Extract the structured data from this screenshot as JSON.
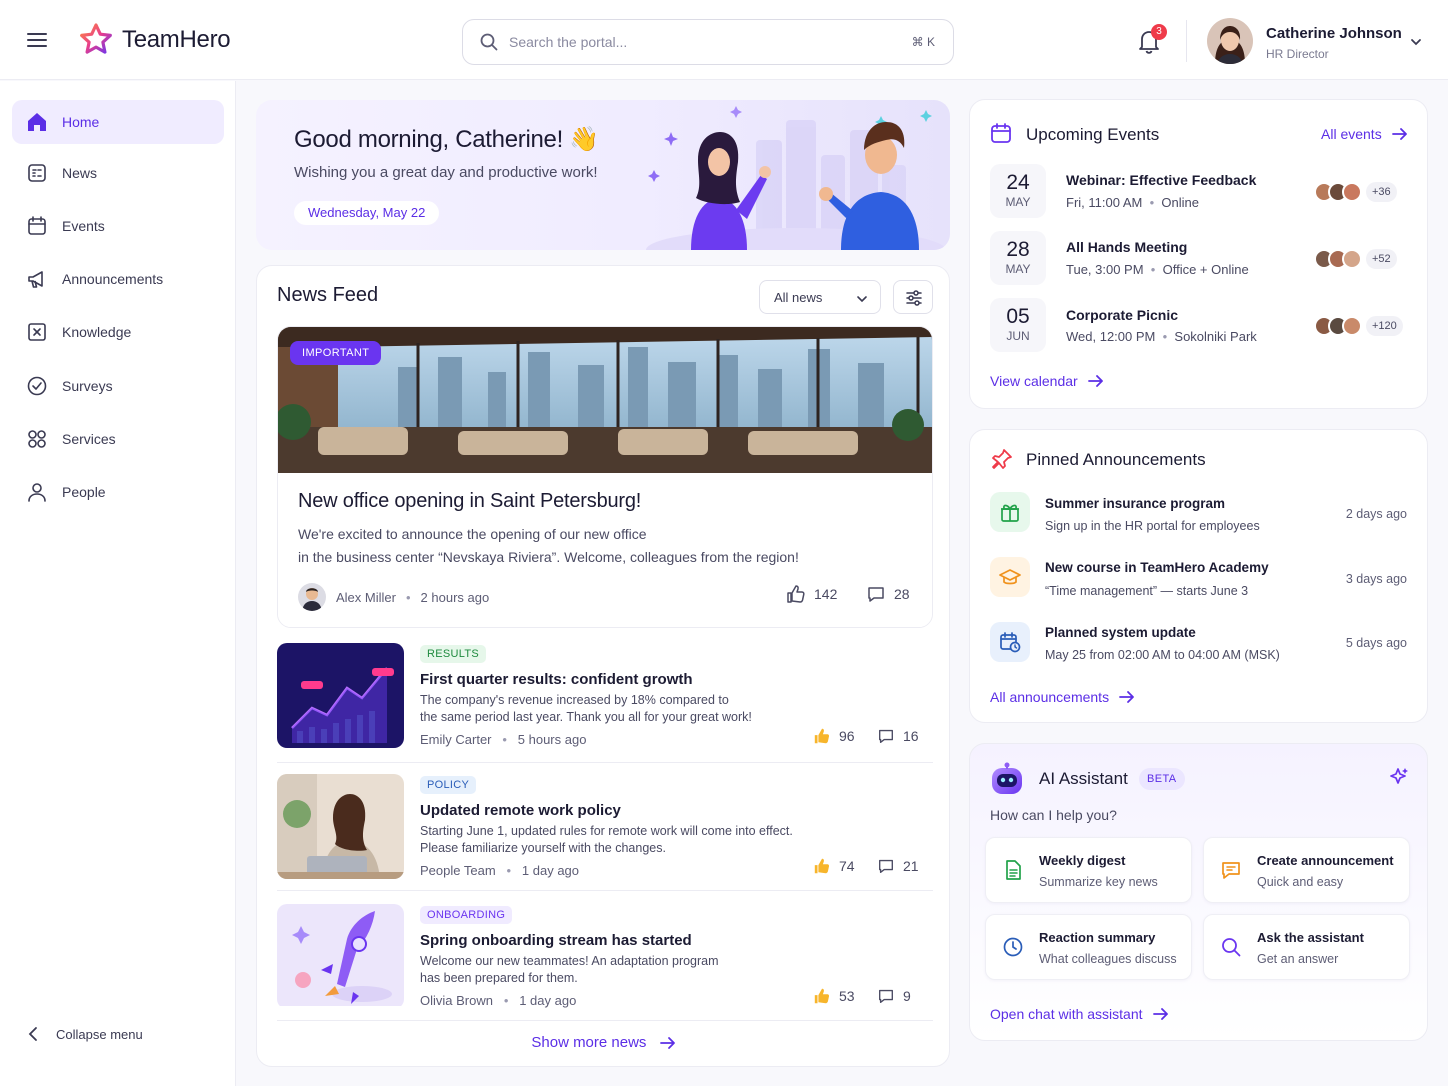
{
  "app": {
    "name": "TeamHero"
  },
  "search": {
    "placeholder": "Search the portal...",
    "shortcut": "⌘ K"
  },
  "notifications": {
    "count": "3"
  },
  "user": {
    "name": "Catherine Johnson",
    "role": "HR Director"
  },
  "sidebar": {
    "items": [
      {
        "label": "Home",
        "icon": "home-icon",
        "active": true
      },
      {
        "label": "News",
        "icon": "news-icon"
      },
      {
        "label": "Events",
        "icon": "calendar-icon"
      },
      {
        "label": "Announcements",
        "icon": "megaphone-icon"
      },
      {
        "label": "Knowledge",
        "icon": "book-icon"
      },
      {
        "label": "Surveys",
        "icon": "check-circle-icon"
      },
      {
        "label": "Services",
        "icon": "grid-icon"
      },
      {
        "label": "People",
        "icon": "person-icon"
      }
    ],
    "collapse_label": "Collapse menu"
  },
  "hero": {
    "greeting": "Good morning, Catherine! 👋",
    "subtitle": "Wishing you a great day and productive work!",
    "date": "Wednesday, May 22"
  },
  "feed": {
    "title": "News Feed",
    "filter": "All news",
    "featured": {
      "badge": "IMPORTANT",
      "title": "New office opening in Saint Petersburg!",
      "text_line1": "We're excited to announce the opening of our new office",
      "text_line2": "in the business center “Nevskaya Riviera”. Welcome, colleagues from the region!",
      "author": "Alex Miller",
      "time": "2 hours ago",
      "likes": "142",
      "comments": "28"
    },
    "items": [
      {
        "tag": "RESULTS",
        "title": "First quarter results: confident growth",
        "text_line1": "The company's revenue increased by 18% compared to",
        "text_line2": "the same period last year. Thank you all for your great work!",
        "author": "Emily Carter",
        "time": "5 hours ago",
        "likes": "96",
        "comments": "16"
      },
      {
        "tag": "POLICY",
        "title": "Updated remote work policy",
        "text_line1": "Starting June 1, updated rules for remote work will come into effect.",
        "text_line2": "Please familiarize yourself with the changes.",
        "author": "People Team",
        "time": "1 day ago",
        "likes": "74",
        "comments": "21"
      },
      {
        "tag": "ONBOARDING",
        "title": "Spring onboarding stream has started",
        "text_line1": "Welcome our new teammates! An adaptation program",
        "text_line2": "has been prepared for them.",
        "author": "Olivia Brown",
        "time": "1 day ago",
        "likes": "53",
        "comments": "9"
      }
    ],
    "show_more": "Show more news"
  },
  "events": {
    "title": "Upcoming Events",
    "all_link": "All events",
    "items": [
      {
        "day": "24",
        "month": "MAY",
        "title": "Webinar: Effective Feedback",
        "when": "Fri, 11:00 AM",
        "where": "Online",
        "more": "+36"
      },
      {
        "day": "28",
        "month": "MAY",
        "title": "All Hands Meeting",
        "when": "Tue, 3:00 PM",
        "where": "Office + Online",
        "more": "+52"
      },
      {
        "day": "05",
        "month": "JUN",
        "title": "Corporate Picnic",
        "when": "Wed, 12:00 PM",
        "where": "Sokolniki Park",
        "more": "+120"
      }
    ],
    "view_calendar": "View calendar"
  },
  "pinned": {
    "title": "Pinned Announcements",
    "items": [
      {
        "title": "Summer insurance program",
        "sub": "Sign up in the HR portal for employees",
        "time": "2 days ago"
      },
      {
        "title": "New course in TeamHero Academy",
        "sub": "“Time management” — starts June 3",
        "time": "3 days ago"
      },
      {
        "title": "Planned system update",
        "sub": "May 25 from 02:00 AM to 04:00 AM (MSK)",
        "time": "5 days ago"
      }
    ],
    "all_link": "All announcements"
  },
  "ai": {
    "title": "AI Assistant",
    "beta": "BETA",
    "question": "How can I help you?",
    "actions": [
      {
        "title": "Weekly digest",
        "sub": "Summarize key news"
      },
      {
        "title": "Create announcement",
        "sub": "Quick and easy"
      },
      {
        "title": "Reaction summary",
        "sub": "What colleagues discuss"
      },
      {
        "title": "Ask the assistant",
        "sub": "Get an answer"
      }
    ],
    "open_chat": "Open chat with assistant"
  }
}
